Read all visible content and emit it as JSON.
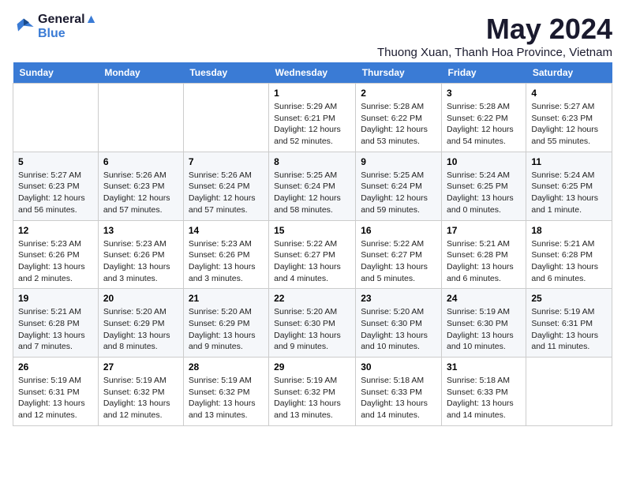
{
  "logo": {
    "line1": "General",
    "line2": "Blue"
  },
  "title": "May 2024",
  "location": "Thuong Xuan, Thanh Hoa Province, Vietnam",
  "weekdays": [
    "Sunday",
    "Monday",
    "Tuesday",
    "Wednesday",
    "Thursday",
    "Friday",
    "Saturday"
  ],
  "weeks": [
    [
      {
        "day": "",
        "info": ""
      },
      {
        "day": "",
        "info": ""
      },
      {
        "day": "",
        "info": ""
      },
      {
        "day": "1",
        "info": "Sunrise: 5:29 AM\nSunset: 6:21 PM\nDaylight: 12 hours\nand 52 minutes."
      },
      {
        "day": "2",
        "info": "Sunrise: 5:28 AM\nSunset: 6:22 PM\nDaylight: 12 hours\nand 53 minutes."
      },
      {
        "day": "3",
        "info": "Sunrise: 5:28 AM\nSunset: 6:22 PM\nDaylight: 12 hours\nand 54 minutes."
      },
      {
        "day": "4",
        "info": "Sunrise: 5:27 AM\nSunset: 6:23 PM\nDaylight: 12 hours\nand 55 minutes."
      }
    ],
    [
      {
        "day": "5",
        "info": "Sunrise: 5:27 AM\nSunset: 6:23 PM\nDaylight: 12 hours\nand 56 minutes."
      },
      {
        "day": "6",
        "info": "Sunrise: 5:26 AM\nSunset: 6:23 PM\nDaylight: 12 hours\nand 57 minutes."
      },
      {
        "day": "7",
        "info": "Sunrise: 5:26 AM\nSunset: 6:24 PM\nDaylight: 12 hours\nand 57 minutes."
      },
      {
        "day": "8",
        "info": "Sunrise: 5:25 AM\nSunset: 6:24 PM\nDaylight: 12 hours\nand 58 minutes."
      },
      {
        "day": "9",
        "info": "Sunrise: 5:25 AM\nSunset: 6:24 PM\nDaylight: 12 hours\nand 59 minutes."
      },
      {
        "day": "10",
        "info": "Sunrise: 5:24 AM\nSunset: 6:25 PM\nDaylight: 13 hours\nand 0 minutes."
      },
      {
        "day": "11",
        "info": "Sunrise: 5:24 AM\nSunset: 6:25 PM\nDaylight: 13 hours\nand 1 minute."
      }
    ],
    [
      {
        "day": "12",
        "info": "Sunrise: 5:23 AM\nSunset: 6:26 PM\nDaylight: 13 hours\nand 2 minutes."
      },
      {
        "day": "13",
        "info": "Sunrise: 5:23 AM\nSunset: 6:26 PM\nDaylight: 13 hours\nand 3 minutes."
      },
      {
        "day": "14",
        "info": "Sunrise: 5:23 AM\nSunset: 6:26 PM\nDaylight: 13 hours\nand 3 minutes."
      },
      {
        "day": "15",
        "info": "Sunrise: 5:22 AM\nSunset: 6:27 PM\nDaylight: 13 hours\nand 4 minutes."
      },
      {
        "day": "16",
        "info": "Sunrise: 5:22 AM\nSunset: 6:27 PM\nDaylight: 13 hours\nand 5 minutes."
      },
      {
        "day": "17",
        "info": "Sunrise: 5:21 AM\nSunset: 6:28 PM\nDaylight: 13 hours\nand 6 minutes."
      },
      {
        "day": "18",
        "info": "Sunrise: 5:21 AM\nSunset: 6:28 PM\nDaylight: 13 hours\nand 6 minutes."
      }
    ],
    [
      {
        "day": "19",
        "info": "Sunrise: 5:21 AM\nSunset: 6:28 PM\nDaylight: 13 hours\nand 7 minutes."
      },
      {
        "day": "20",
        "info": "Sunrise: 5:20 AM\nSunset: 6:29 PM\nDaylight: 13 hours\nand 8 minutes."
      },
      {
        "day": "21",
        "info": "Sunrise: 5:20 AM\nSunset: 6:29 PM\nDaylight: 13 hours\nand 9 minutes."
      },
      {
        "day": "22",
        "info": "Sunrise: 5:20 AM\nSunset: 6:30 PM\nDaylight: 13 hours\nand 9 minutes."
      },
      {
        "day": "23",
        "info": "Sunrise: 5:20 AM\nSunset: 6:30 PM\nDaylight: 13 hours\nand 10 minutes."
      },
      {
        "day": "24",
        "info": "Sunrise: 5:19 AM\nSunset: 6:30 PM\nDaylight: 13 hours\nand 10 minutes."
      },
      {
        "day": "25",
        "info": "Sunrise: 5:19 AM\nSunset: 6:31 PM\nDaylight: 13 hours\nand 11 minutes."
      }
    ],
    [
      {
        "day": "26",
        "info": "Sunrise: 5:19 AM\nSunset: 6:31 PM\nDaylight: 13 hours\nand 12 minutes."
      },
      {
        "day": "27",
        "info": "Sunrise: 5:19 AM\nSunset: 6:32 PM\nDaylight: 13 hours\nand 12 minutes."
      },
      {
        "day": "28",
        "info": "Sunrise: 5:19 AM\nSunset: 6:32 PM\nDaylight: 13 hours\nand 13 minutes."
      },
      {
        "day": "29",
        "info": "Sunrise: 5:19 AM\nSunset: 6:32 PM\nDaylight: 13 hours\nand 13 minutes."
      },
      {
        "day": "30",
        "info": "Sunrise: 5:18 AM\nSunset: 6:33 PM\nDaylight: 13 hours\nand 14 minutes."
      },
      {
        "day": "31",
        "info": "Sunrise: 5:18 AM\nSunset: 6:33 PM\nDaylight: 13 hours\nand 14 minutes."
      },
      {
        "day": "",
        "info": ""
      }
    ]
  ]
}
